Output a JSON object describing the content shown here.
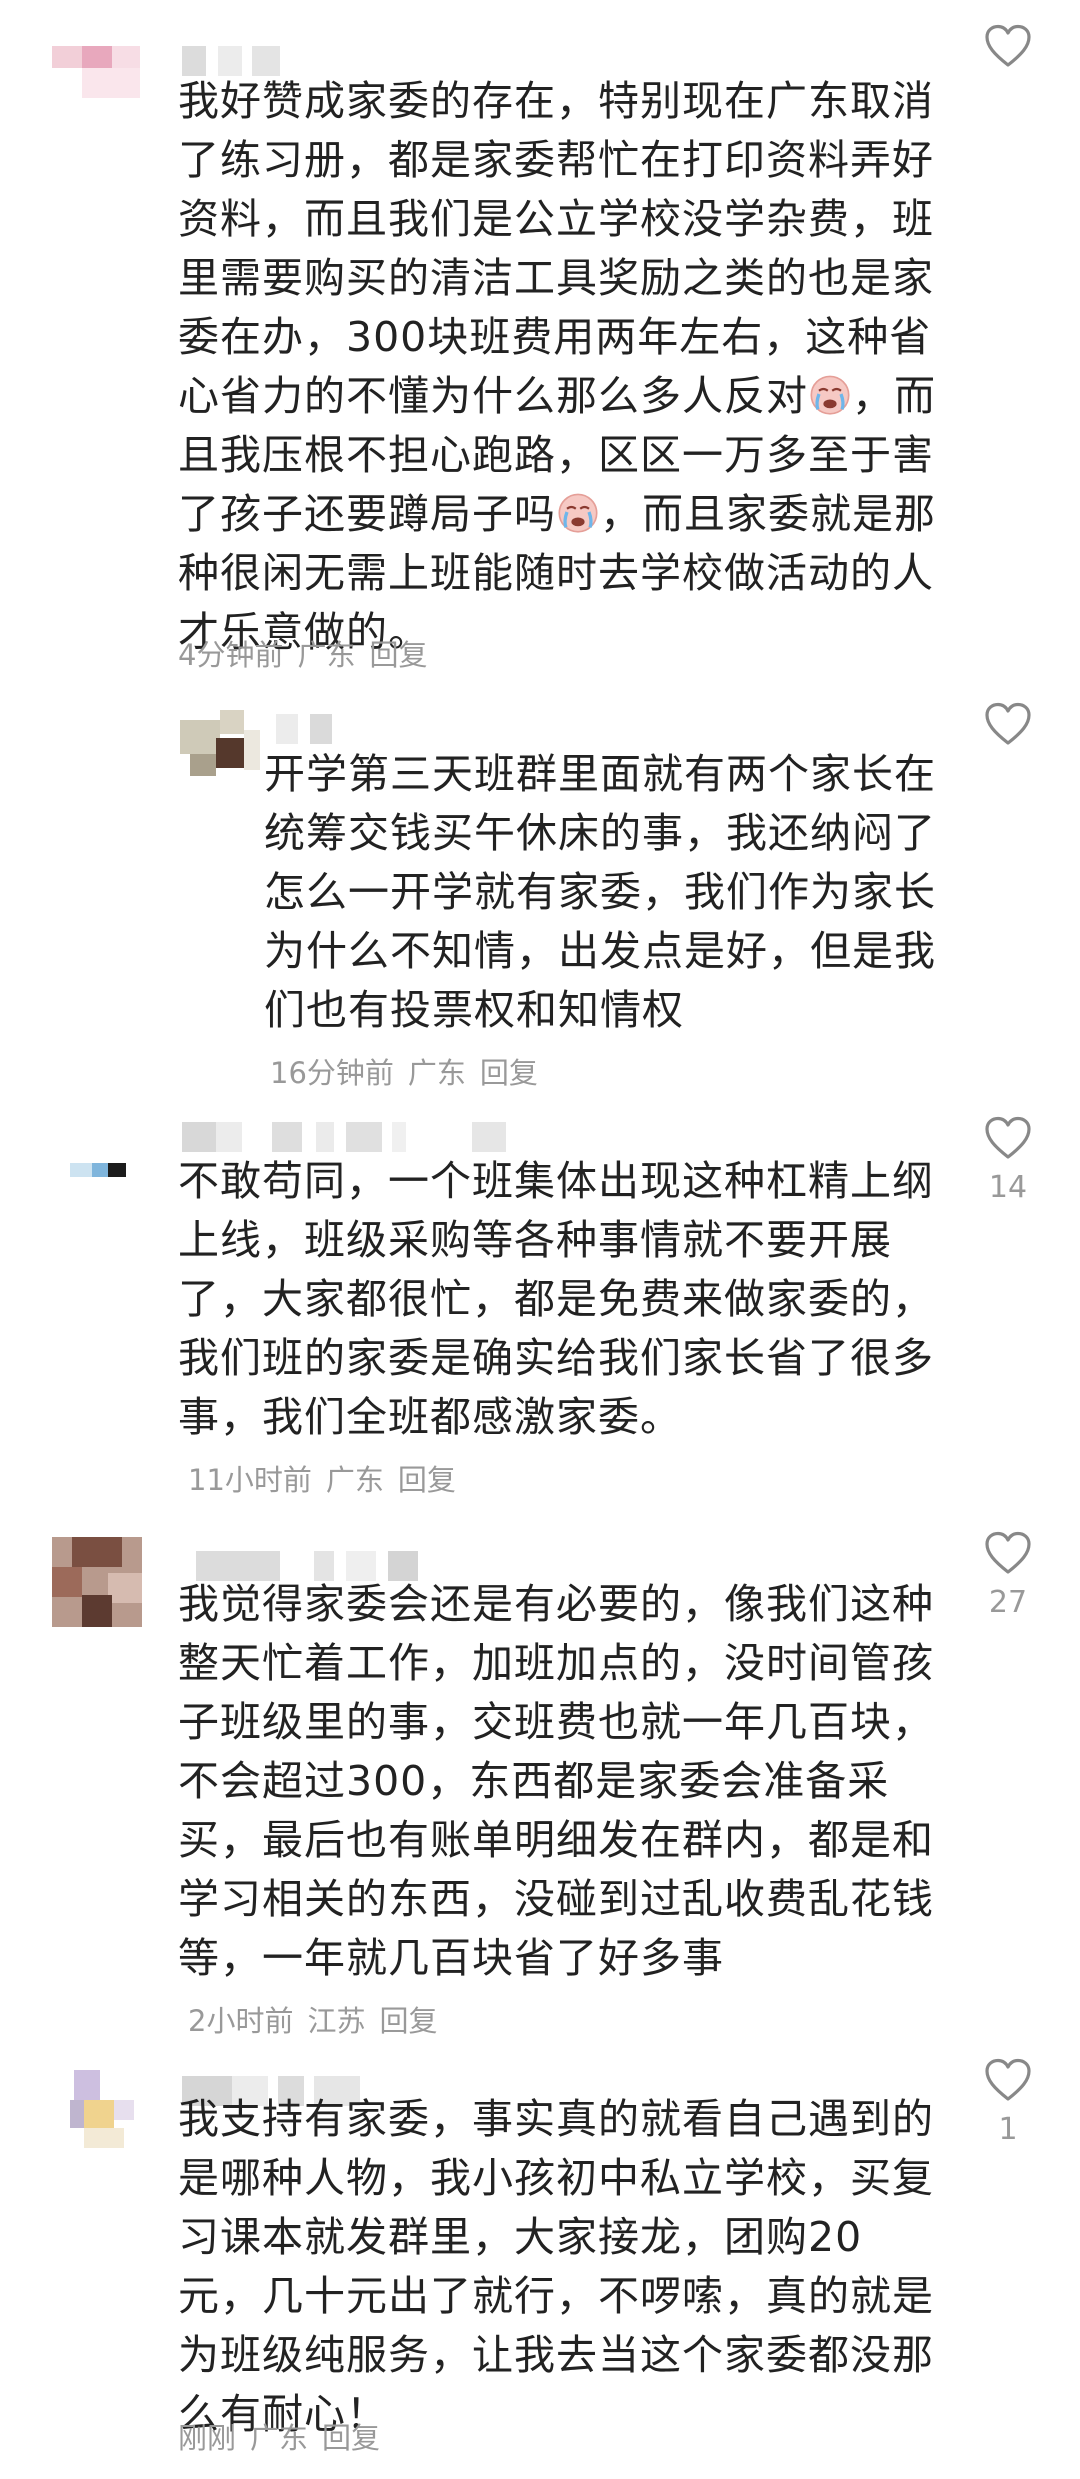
{
  "comments": [
    {
      "text": "我好赞成家委的存在，特别现在广东取消了练习册，都是家委帮忙在打印资料弄好资料，而且我们是公立学校没学杂费，班里需要购买的清洁工具奖励之类的也是家委在办，300块班费用两年左右，这种省心省力的不懂为什么那么多人反对",
      "text_mid": "，而且我压根不担心跑路，区区一万多至于害了孩子还要蹲局子吗",
      "text_end": "，而且家委就是那种很闲无需上班能随时去学校做活动的人才乐意做的。",
      "time": "4分钟前",
      "location": "广东",
      "reply": "回复",
      "likes": "",
      "emoji": "crying-face-icon"
    },
    {
      "text": "开学第三天班群里面就有两个家长在统筹交钱买午休床的事，我还纳闷了怎么一开学就有家委，我们作为家长为什么不知情，出发点是好，但是我们也有投票权和知情权",
      "time": "16分钟前",
      "location": "广东",
      "reply": "回复",
      "likes": ""
    },
    {
      "text": "不敢苟同，一个班集体出现这种杠精上纲上线，班级采购等各种事情就不要开展了，大家都很忙，都是免费来做家委的，我们班的家委是确实给我们家长省了很多事，我们全班都感激家委。",
      "time": "11小时前",
      "location": "广东",
      "reply": "回复",
      "likes": "14"
    },
    {
      "text": "我觉得家委会还是有必要的，像我们这种整天忙着工作，加班加点的，没时间管孩子班级里的事，交班费也就一年几百块，不会超过300，东西都是家委会准备采买，最后也有账单明细发在群内，都是和学习相关的东西，没碰到过乱收费乱花钱等，一年就几百块省了好多事",
      "time": "2小时前",
      "location": "江苏",
      "reply": "回复",
      "likes": "27"
    },
    {
      "text": "我支持有家委，事实真的就看自己遇到的是哪种人物，我小孩初中私立学校，买复习课本就发群里，大家接龙，团购20元，几十元出了就行，不啰嗦，真的就是为班级纯服务，让我去当这个家委都没那么有耐心！",
      "time": "刚刚",
      "location": "广东",
      "reply": "回复",
      "likes": "1"
    }
  ],
  "colors": {
    "text": "#222222",
    "meta": "#999999",
    "icon": "#888888"
  }
}
